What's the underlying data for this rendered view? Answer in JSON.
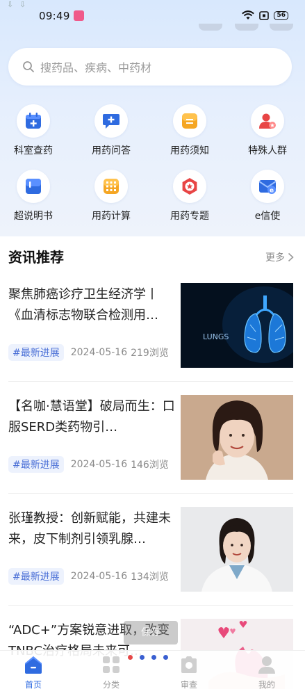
{
  "status_bar": {
    "time": "09:49",
    "battery": "56"
  },
  "search": {
    "placeholder": "搜药品、疾病、中药材"
  },
  "grid": [
    {
      "label": "科室查药",
      "icon": "calendar-plus-icon"
    },
    {
      "label": "用药问答",
      "icon": "chat-plus-icon"
    },
    {
      "label": "用药须知",
      "icon": "notice-icon"
    },
    {
      "label": "特殊人群",
      "icon": "special-people-icon"
    },
    {
      "label": "超说明书",
      "icon": "book-icon"
    },
    {
      "label": "用药计算",
      "icon": "calculator-icon"
    },
    {
      "label": "用药专题",
      "icon": "star-badge-icon"
    },
    {
      "label": "e信使",
      "icon": "email-icon"
    }
  ],
  "news": {
    "title": "资讯推荐",
    "more": "更多",
    "articles": [
      {
        "title": "聚焦肺癌诊疗卫生经济学丨《血清标志物联合检测用…",
        "tag": "#最新进展",
        "date": "2024-05-16",
        "views": "219浏览",
        "image_text": "LUNGS"
      },
      {
        "title": "【名咖·慧语堂】破局而生：口服SERD类药物引…",
        "tag": "#最新进展",
        "date": "2024-05-16",
        "views": "146浏览"
      },
      {
        "title": "张瑾教授：创新赋能，共建未来，皮下制剂引领乳腺…",
        "tag": "#最新进展",
        "date": "2024-05-16",
        "views": "134浏览"
      },
      {
        "title": "“ADC+”方案锐意进取，改变TNBC治疗格局未来可…"
      }
    ]
  },
  "toast": "保存",
  "bottom_nav": [
    {
      "label": "首页",
      "icon": "home-icon",
      "active": true
    },
    {
      "label": "分类",
      "icon": "category-icon",
      "active": false
    },
    {
      "label": "审查",
      "icon": "review-icon",
      "active": false
    },
    {
      "label": "我的",
      "icon": "profile-icon",
      "active": false
    }
  ],
  "colors": {
    "accent": "#2f6be0",
    "tag_text": "#4a6fd6",
    "tag_bg": "#edf2fd"
  }
}
